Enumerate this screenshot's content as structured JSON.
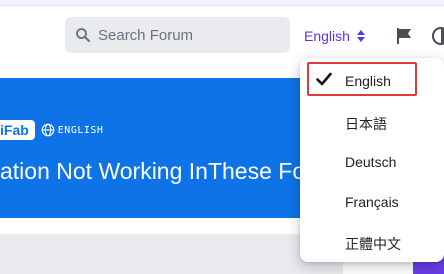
{
  "header": {
    "search": {
      "placeholder": "Search Forum"
    },
    "language_toggle": {
      "label": "English"
    }
  },
  "banner": {
    "brand": "iFab",
    "language_tag": "ENGLISH",
    "title": "ation Not Working InThese Fo"
  },
  "language_menu": {
    "selected": "English",
    "items": [
      {
        "label": "English"
      },
      {
        "label": "日本語"
      },
      {
        "label": "Deutsch"
      },
      {
        "label": "Français"
      },
      {
        "label": "正體中文"
      }
    ]
  },
  "colors": {
    "accent": "#5b33e6",
    "banner_blue": "#0d73e6",
    "highlight_red": "#e0393b",
    "purple_bar": "#6a3de8"
  }
}
